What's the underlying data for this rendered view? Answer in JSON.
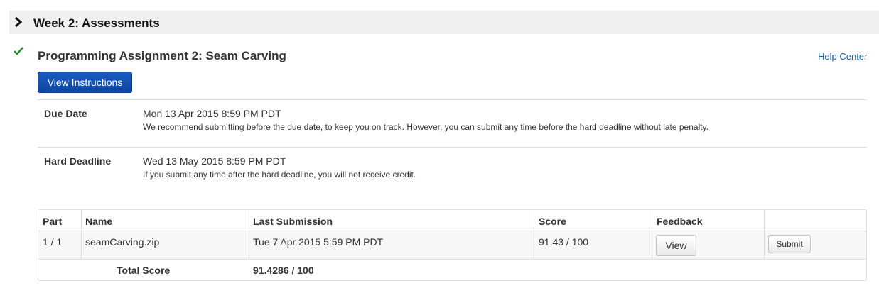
{
  "week": {
    "title": "Week 2: Assessments"
  },
  "assignment": {
    "title": "Programming Assignment 2: Seam Carving",
    "completed": true,
    "view_instructions_label": "View Instructions",
    "help_center_label": "Help Center"
  },
  "deadlines": {
    "due": {
      "label": "Due Date",
      "value": "Mon 13 Apr 2015 8:59 PM PDT",
      "note": "We recommend submitting before the due date, to keep you on track. However, you can submit any time before the hard deadline without late penalty."
    },
    "hard": {
      "label": "Hard Deadline",
      "value": "Wed 13 May 2015 8:59 PM PDT",
      "note": "If you submit any time after the hard deadline, you will not receive credit."
    }
  },
  "table": {
    "headers": [
      "Part",
      "Name",
      "Last Submission",
      "Score",
      "Feedback"
    ],
    "rows": [
      {
        "part": "1 / 1",
        "name": "seamCarving.zip",
        "last_submission": "Tue 7 Apr 2015 5:59 PM PDT",
        "score": "91.43 / 100",
        "feedback_button": "View",
        "submit_button": "Submit"
      }
    ],
    "total": {
      "label": "Total Score",
      "value": "91.4286 / 100"
    }
  },
  "colors": {
    "accent_button": "#0d46a4",
    "link": "#1f5fa8",
    "check": "#2e8b2e",
    "header_bg": "#f0f0f0"
  }
}
